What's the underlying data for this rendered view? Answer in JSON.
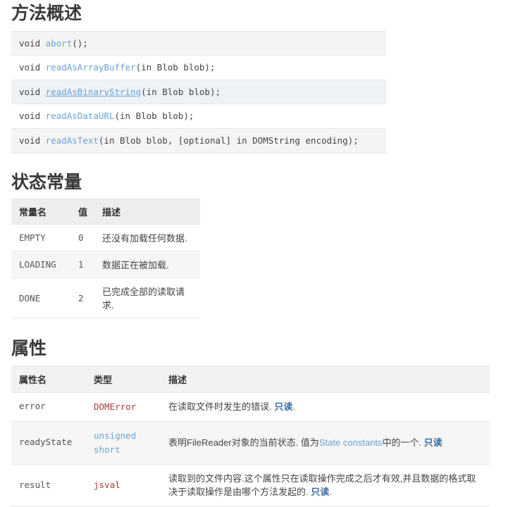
{
  "sections": {
    "methods": {
      "title": "方法概述",
      "rows": [
        {
          "ret": "void ",
          "name": "abort",
          "rest": "();",
          "link": "plain",
          "highlight": false
        },
        {
          "ret": "void ",
          "name": "readAsArrayBuffer",
          "rest": "(in Blob blob);",
          "link": "plain",
          "highlight": false
        },
        {
          "ret": "void ",
          "name": "readAsBinaryString",
          "rest": "(in Blob blob);",
          "link": "underline",
          "highlight": true
        },
        {
          "ret": "void ",
          "name": "readAsDataURL",
          "rest": "(in Blob blob);",
          "link": "plain",
          "highlight": false
        },
        {
          "ret": "void ",
          "name": "readAsText",
          "rest": "(in Blob blob, [optional] in DOMString encoding);",
          "link": "plain",
          "highlight": false
        }
      ]
    },
    "state_constants": {
      "title": "状态常量",
      "headers": [
        "常量名",
        "值",
        "描述"
      ],
      "rows": [
        {
          "name": "EMPTY",
          "value": "0",
          "desc": "还没有加载任何数据."
        },
        {
          "name": "LOADING",
          "value": "1",
          "desc": "数据正在被加载."
        },
        {
          "name": "DONE",
          "value": "2",
          "desc": "已完成全部的读取请求."
        }
      ]
    },
    "properties": {
      "title": "属性",
      "headers": [
        "属性名",
        "类型",
        "描述"
      ],
      "rows": [
        {
          "name": "error",
          "type": "DOMError",
          "type_style": "red-link",
          "desc_parts": [
            {
              "text": "在读取文件时发生的错误. ",
              "style": "plain"
            },
            {
              "text": "只读",
              "style": "strong-link"
            },
            {
              "text": ".",
              "style": "plain"
            }
          ]
        },
        {
          "name": "readyState",
          "type": "unsigned short",
          "type_style": "blue-link",
          "desc_parts": [
            {
              "text": "表明FileReader对象的当前状态. 值为",
              "style": "plain"
            },
            {
              "text": "State constants",
              "style": "blue-link"
            },
            {
              "text": "中的一个. ",
              "style": "plain"
            },
            {
              "text": "只读",
              "style": "strong-link"
            }
          ]
        },
        {
          "name": "result",
          "type": "jsval",
          "type_style": "red-link",
          "desc_parts": [
            {
              "text": "读取到的文件内容.这个属性只在读取操作完成之后才有效,并且数据的格式取决于读取操作是由哪个方法发起的. ",
              "style": "plain"
            },
            {
              "text": "只读",
              "style": "strong-link"
            },
            {
              "text": ".",
              "style": "plain"
            }
          ]
        }
      ]
    }
  },
  "colors": {
    "link_blue": "#68a3d6",
    "link_strong_blue": "#3a6ea5",
    "link_red": "#b03535",
    "heading": "#3a3a3a",
    "body_text": "#444444",
    "header_bg": "#eeeeee",
    "row_alt_bg": "#f6f6f6",
    "highlight_row_bg": "#eef2f7"
  }
}
